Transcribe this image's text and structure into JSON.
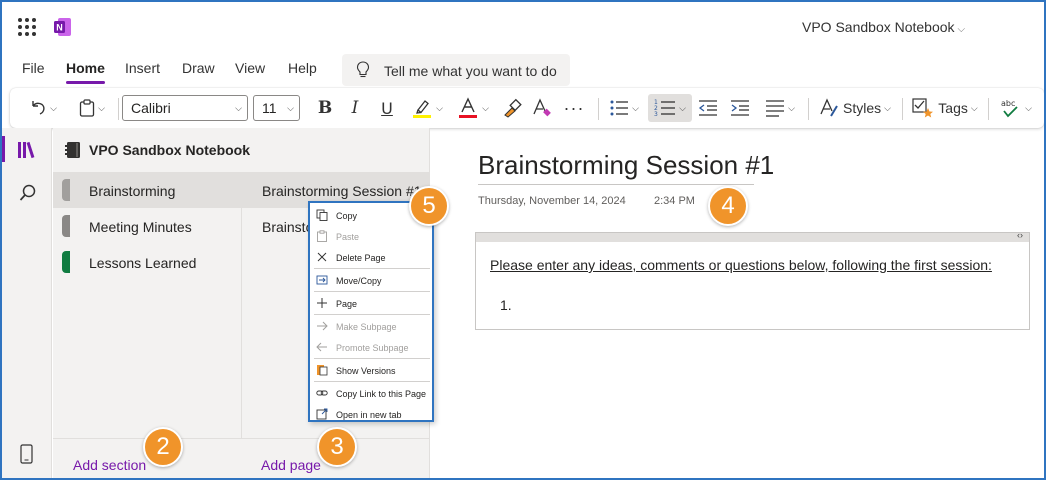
{
  "titlebar": {
    "notebook_title": "VPO Sandbox Notebook"
  },
  "menu": {
    "tabs": [
      "File",
      "Home",
      "Insert",
      "Draw",
      "View",
      "Help"
    ],
    "active_tab": "Home",
    "tell_me_placeholder": "Tell me what you want to do"
  },
  "ribbon": {
    "font_name": "Calibri",
    "font_size": "11",
    "styles_label": "Styles",
    "tags_label": "Tags",
    "spell_label": "abc"
  },
  "panel": {
    "notebook_name": "VPO Sandbox Notebook",
    "sections": [
      {
        "label": "Brainstorming",
        "color": "#a19f9d"
      },
      {
        "label": "Meeting Minutes",
        "color": "#8a8886"
      },
      {
        "label": "Lessons Learned",
        "color": "#107c41"
      }
    ],
    "pages": [
      {
        "label": "Brainstorming Session #1"
      },
      {
        "label": "Brainstorming Session #2"
      }
    ],
    "add_section": "Add section",
    "add_page": "Add page"
  },
  "context_menu": {
    "items": [
      {
        "label": "Copy",
        "icon": "copy-icon",
        "disabled": false
      },
      {
        "label": "Paste",
        "icon": "paste-icon",
        "disabled": true
      },
      {
        "label": "Delete Page",
        "icon": "close-icon",
        "disabled": false
      },
      {
        "label": "Move/Copy",
        "icon": "move-copy-icon",
        "disabled": false
      },
      {
        "label": "Page",
        "icon": "plus-icon",
        "disabled": false
      },
      {
        "label": "Make Subpage",
        "icon": "arrow-right-icon",
        "disabled": true
      },
      {
        "label": "Promote Subpage",
        "icon": "arrow-left-icon",
        "disabled": true
      },
      {
        "label": "Show Versions",
        "icon": "versions-icon",
        "disabled": false
      },
      {
        "label": "Copy Link to this Page",
        "icon": "link-icon",
        "disabled": false
      },
      {
        "label": "Open in new tab",
        "icon": "new-tab-icon",
        "disabled": false
      }
    ]
  },
  "callouts": [
    "2",
    "3",
    "4",
    "5"
  ],
  "page": {
    "title": "Brainstorming Session #1",
    "date": "Thursday, November 14, 2024",
    "time": "2:34 PM",
    "note_text": "Please enter any ideas, comments or questions below, following the first session:",
    "list_item_number": "1."
  },
  "colors": {
    "accent": "#7719aa",
    "callout": "#f0942a",
    "frame": "#2f74c0"
  }
}
